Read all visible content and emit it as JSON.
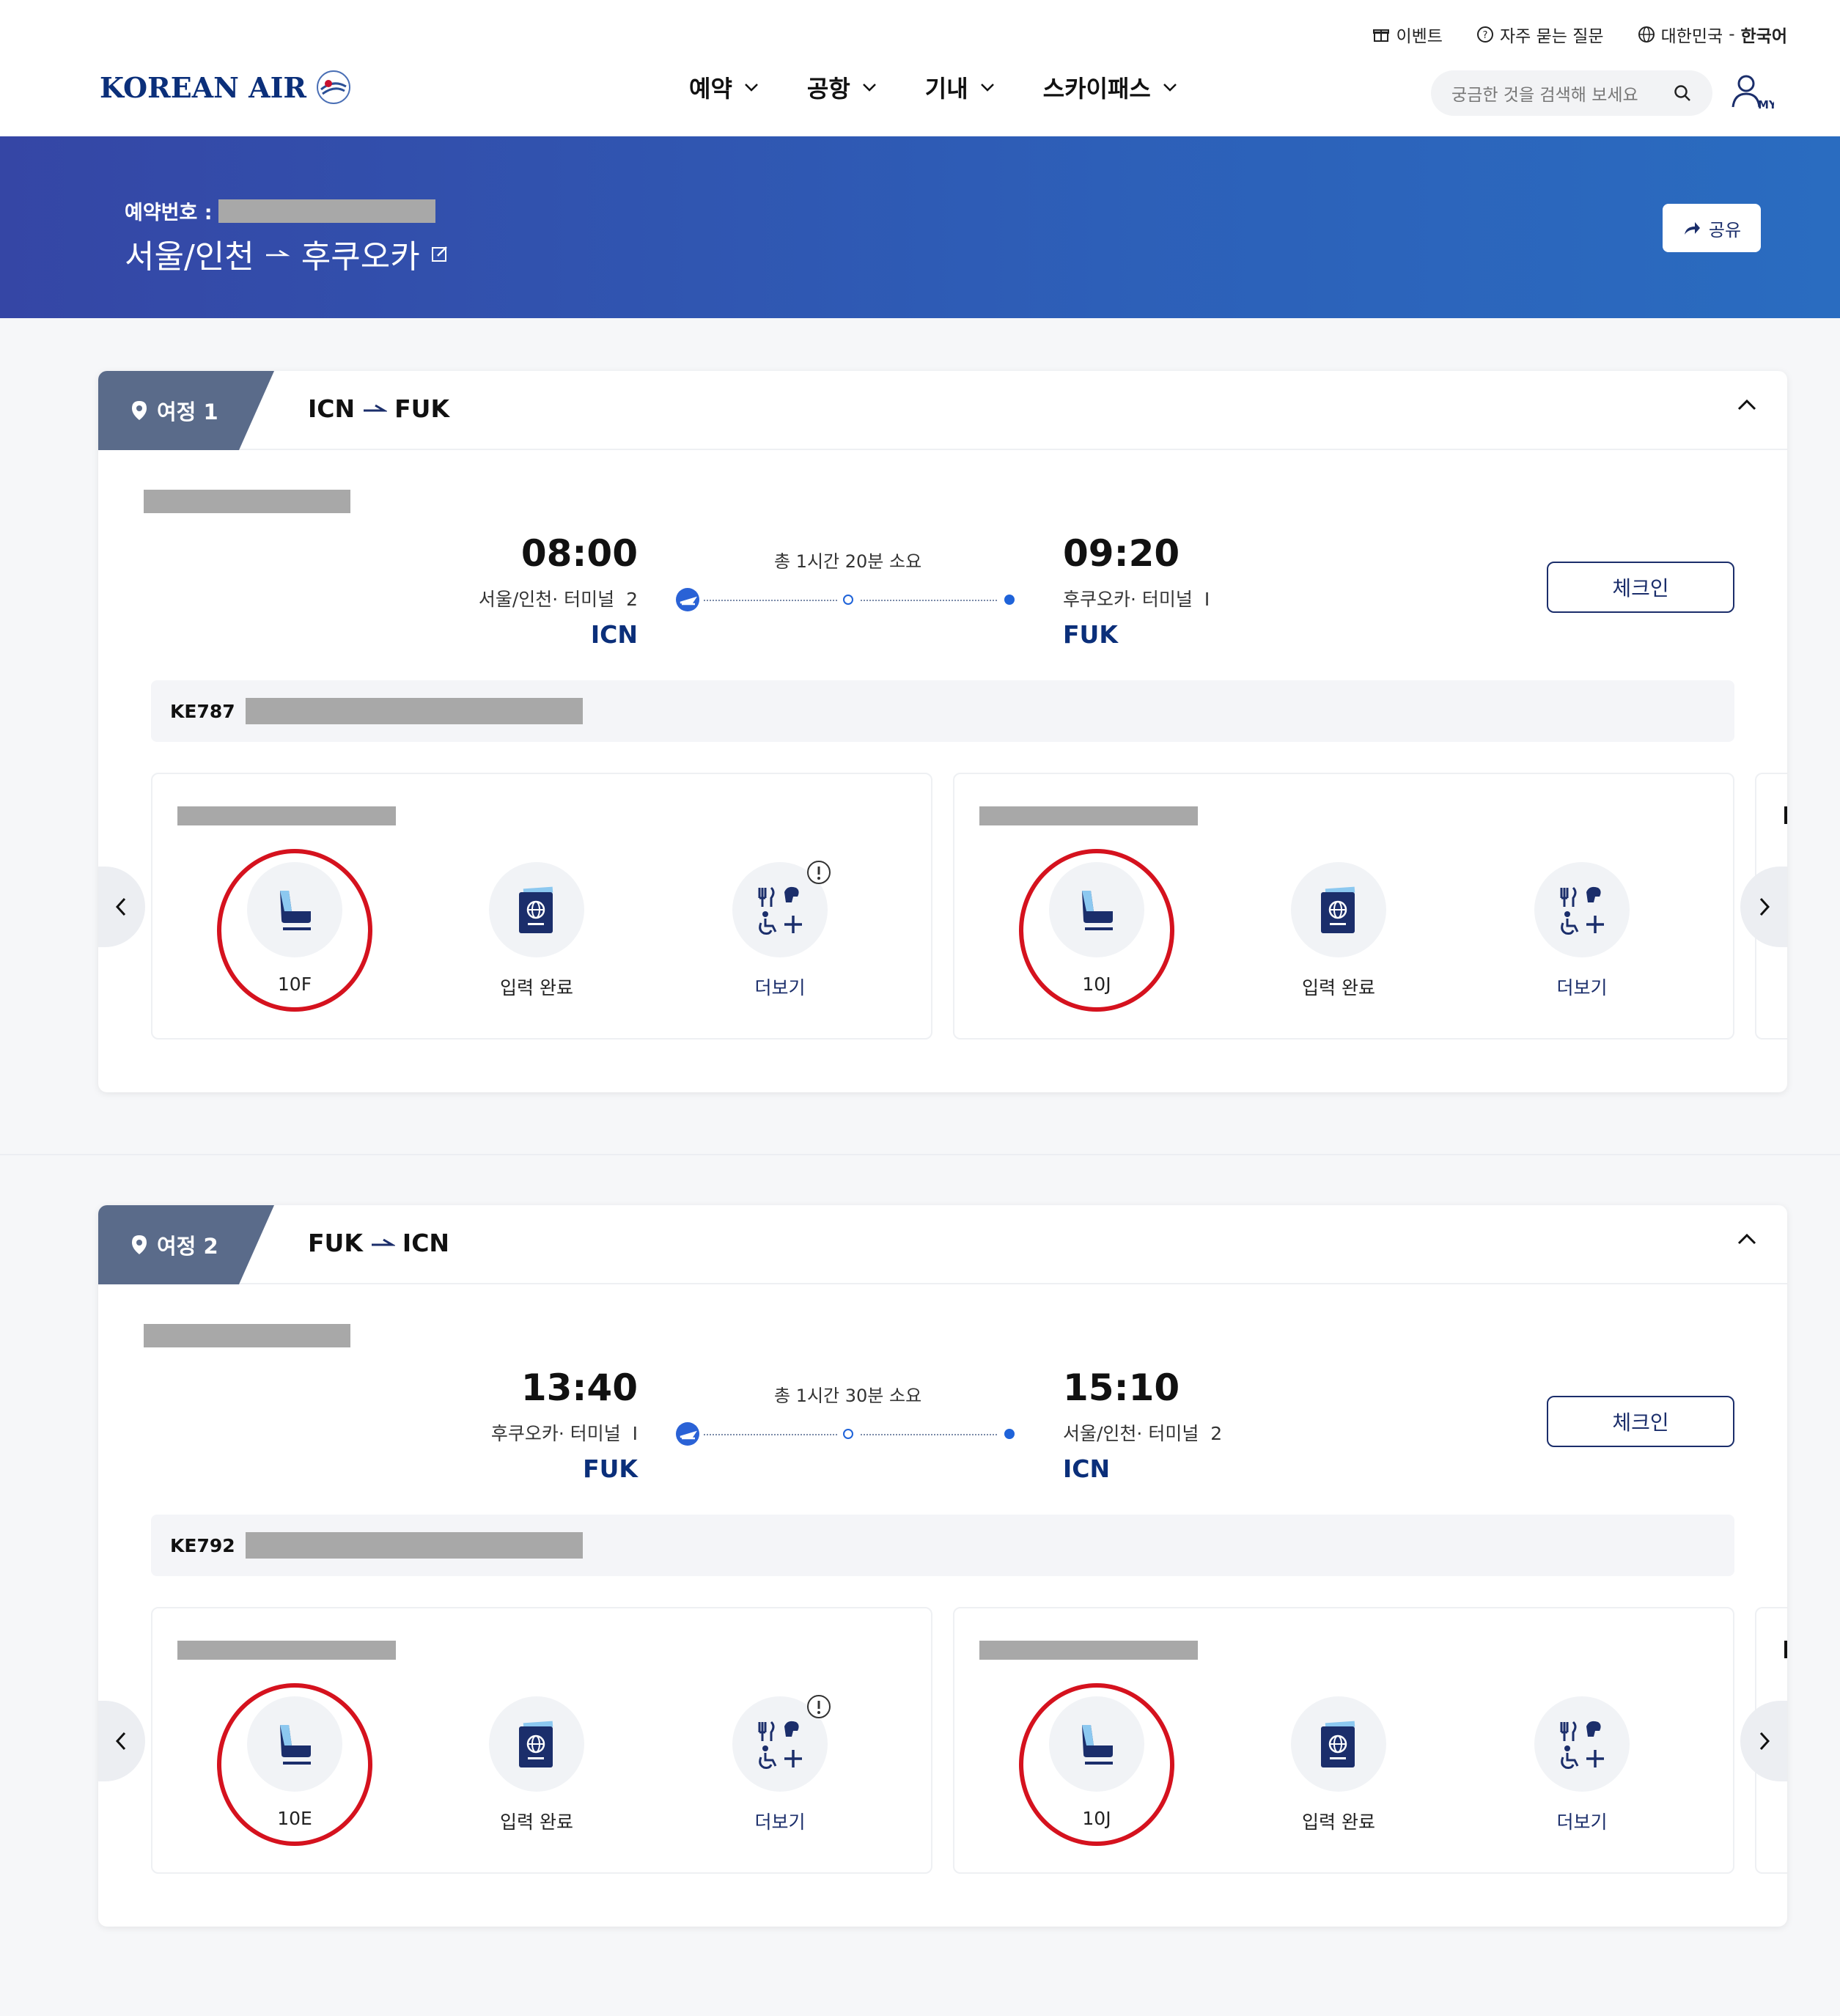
{
  "header": {
    "logo_text": "KOREAN AIR",
    "util_links": [
      {
        "icon": "gift-icon",
        "label": "이벤트"
      },
      {
        "icon": "question-circle-icon",
        "label": "자주 묻는 질문"
      },
      {
        "icon": "globe-icon",
        "region": "대한민국",
        "separator": " - ",
        "language": "한국어"
      }
    ],
    "nav": [
      "예약",
      "공항",
      "기내",
      "스카이패스"
    ],
    "search_placeholder": "궁금한 것을 검색해 보세요",
    "my_label": "MY"
  },
  "banner": {
    "reservation_label": "예약번호 :",
    "origin": "서울/인천",
    "destination": "후쿠오카",
    "share_label": "공유"
  },
  "itineraries": [
    {
      "tab_label": "여정 1",
      "route_from": "ICN",
      "route_to": "FUK",
      "duration": "총 1시간 20분 소요",
      "depart": {
        "time": "08:00",
        "place": "서울/인천· 터미널",
        "terminal": "2",
        "code": "ICN"
      },
      "arrive": {
        "time": "09:20",
        "place": "후쿠오카· 터미널",
        "terminal": "I",
        "code": "FUK"
      },
      "checkin_label": "체크인",
      "flight_no": "KE787",
      "passengers": [
        {
          "seat": "10F",
          "passport_label": "입력 완료",
          "more_label": "더보기",
          "has_alert": true
        },
        {
          "seat": "10J",
          "passport_label": "입력 완료",
          "more_label": "더보기",
          "has_alert": false
        }
      ]
    },
    {
      "tab_label": "여정 2",
      "route_from": "FUK",
      "route_to": "ICN",
      "duration": "총 1시간 30분 소요",
      "depart": {
        "time": "13:40",
        "place": "후쿠오카· 터미널",
        "terminal": "I",
        "code": "FUK"
      },
      "arrive": {
        "time": "15:10",
        "place": "서울/인천· 터미널",
        "terminal": "2",
        "code": "ICN"
      },
      "checkin_label": "체크인",
      "flight_no": "KE792",
      "passengers": [
        {
          "seat": "10E",
          "passport_label": "입력 완료",
          "more_label": "더보기",
          "has_alert": true
        },
        {
          "seat": "10J",
          "passport_label": "입력 완료",
          "more_label": "더보기",
          "has_alert": false
        }
      ]
    }
  ],
  "colors": {
    "brand_navy": "#1b2e6b",
    "highlight_red": "#d5121e",
    "banner_blue": "#2d5fb8"
  }
}
